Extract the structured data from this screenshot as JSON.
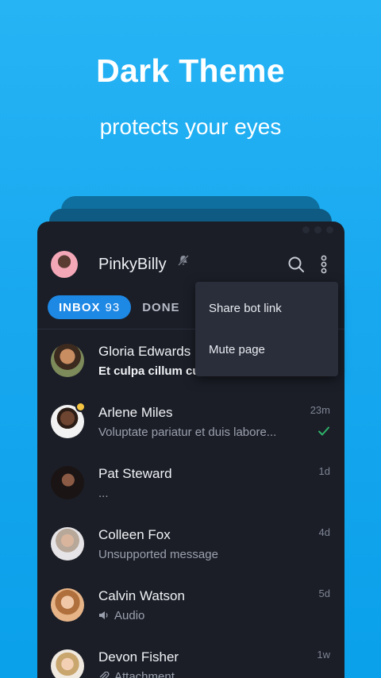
{
  "promo": {
    "headline": "Dark Theme",
    "subline": "protects your eyes"
  },
  "header": {
    "title": "PinkyBilly"
  },
  "tabs": {
    "inbox_label": "INBOX",
    "inbox_count": "93",
    "done_label": "DONE"
  },
  "menu": {
    "items": [
      {
        "label": "Share bot link"
      },
      {
        "label": "Mute page"
      }
    ]
  },
  "conversations": [
    {
      "name": "Gloria Edwards",
      "message": "Et culpa cillum cu",
      "time": "",
      "unread": true
    },
    {
      "name": "Arlene Miles",
      "message": "Voluptate pariatur et duis labore...",
      "time": "23m",
      "delivered": true
    },
    {
      "name": "Pat Steward",
      "message": "...",
      "time": "1d"
    },
    {
      "name": "Colleen Fox",
      "message": "Unsupported message",
      "time": "4d"
    },
    {
      "name": "Calvin Watson",
      "message": "Audio",
      "time": "5d",
      "icon": "audio-icon"
    },
    {
      "name": "Devon Fisher",
      "message": "Attachment",
      "time": "1w",
      "icon": "attachment-icon"
    }
  ],
  "colors": {
    "background": "#18a8ef",
    "panel": "#1b1e27",
    "accent": "#1e88e5",
    "check": "#2fb36a"
  }
}
